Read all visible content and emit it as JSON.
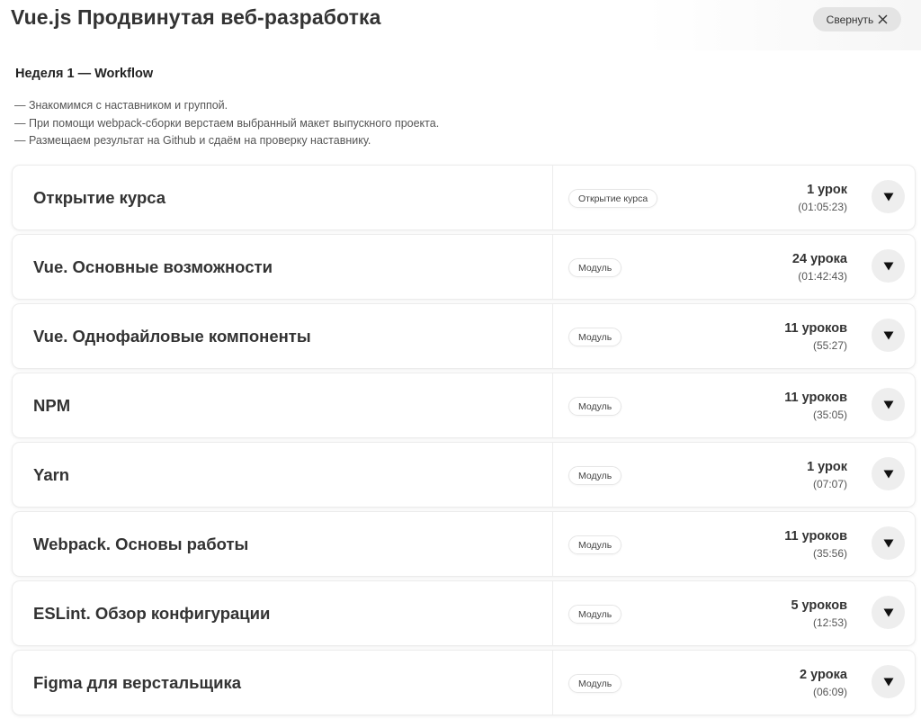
{
  "header": {
    "title": "Vue.js Продвинутая веб-разработка",
    "collapse_label": "Свернуть"
  },
  "week": {
    "title": "Неделя 1 — Workflow",
    "lines": [
      "— Знакомимся с наставником и группой.",
      "— При помощи webpack-сборки верстаем выбранный макет выпускного проекта.",
      "— Размещаем результат на Github и сдаём на проверку наставнику."
    ]
  },
  "modules": [
    {
      "title": "Открытие курса",
      "tag": "Открытие курса",
      "lessons": "1 урок",
      "duration": "(01:05:23)"
    },
    {
      "title": "Vue. Основные возможности",
      "tag": "Модуль",
      "lessons": "24 урока",
      "duration": "(01:42:43)"
    },
    {
      "title": "Vue. Однофайловые компоненты",
      "tag": "Модуль",
      "lessons": "11 уроков",
      "duration": "(55:27)"
    },
    {
      "title": "NPM",
      "tag": "Модуль",
      "lessons": "11 уроков",
      "duration": "(35:05)"
    },
    {
      "title": "Yarn",
      "tag": "Модуль",
      "lessons": "1 урок",
      "duration": "(07:07)"
    },
    {
      "title": "Webpack. Основы работы",
      "tag": "Модуль",
      "lessons": "11 уроков",
      "duration": "(35:56)"
    },
    {
      "title": "ESLint. Обзор конфигурации",
      "tag": "Модуль",
      "lessons": "5 уроков",
      "duration": "(12:53)"
    },
    {
      "title": "Figma для верстальщика",
      "tag": "Модуль",
      "lessons": "2 урока",
      "duration": "(06:09)"
    }
  ],
  "icons": {
    "collapse": "close-icon",
    "expand": "triangle-down-icon"
  }
}
